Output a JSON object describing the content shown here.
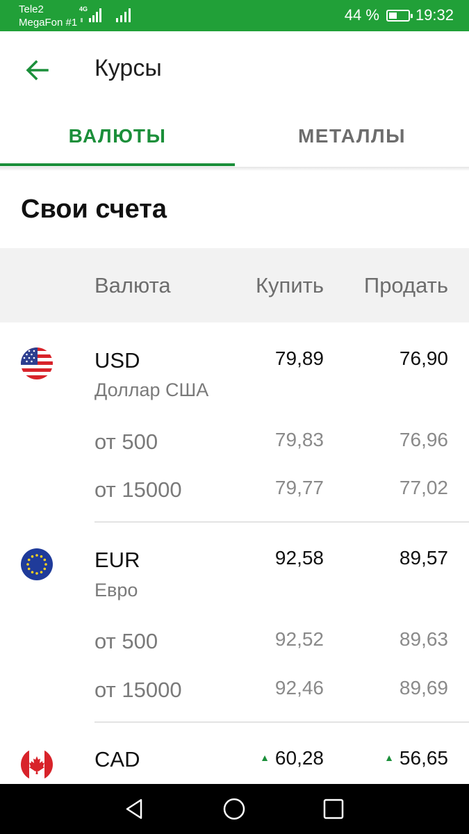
{
  "status_bar": {
    "carrier1": "Tele2",
    "carrier2": "MegaFon #1",
    "network": "4G",
    "battery_text": "44 %",
    "battery_level": 0.44,
    "time": "19:32",
    "bg_color": "#21a038"
  },
  "app_bar": {
    "back_icon": "arrow-left-icon",
    "title": "Курсы"
  },
  "tabs": [
    {
      "label": "ВАЛЮТЫ",
      "active": true
    },
    {
      "label": "МЕТАЛЛЫ",
      "active": false
    }
  ],
  "section_title": "Свои счета",
  "table_header": {
    "currency": "Валюта",
    "buy": "Купить",
    "sell": "Продать"
  },
  "currencies": [
    {
      "code": "USD",
      "name": "Доллар США",
      "flag_icon": "us-flag-icon",
      "buy": "79,89",
      "sell": "76,90",
      "tiers": [
        {
          "label": "от 500",
          "buy": "79,83",
          "sell": "76,96"
        },
        {
          "label": "от 15000",
          "buy": "79,77",
          "sell": "77,02"
        }
      ]
    },
    {
      "code": "EUR",
      "name": "Евро",
      "flag_icon": "eu-flag-icon",
      "buy": "92,58",
      "sell": "89,57",
      "tiers": [
        {
          "label": "от 500",
          "buy": "92,52",
          "sell": "89,63"
        },
        {
          "label": "от 15000",
          "buy": "92,46",
          "sell": "89,69"
        }
      ]
    },
    {
      "code": "CAD",
      "flag_icon": "ca-flag-icon",
      "buy": "60,28",
      "sell": "56,65",
      "trend": "up"
    }
  ],
  "nav_bar": {
    "back_icon": "nav-back-icon",
    "home_icon": "nav-home-icon",
    "recents_icon": "nav-recents-icon"
  },
  "colors": {
    "accent": "#1b8f3a",
    "status_bar": "#21a038",
    "header_bg": "#f2f2f2"
  }
}
